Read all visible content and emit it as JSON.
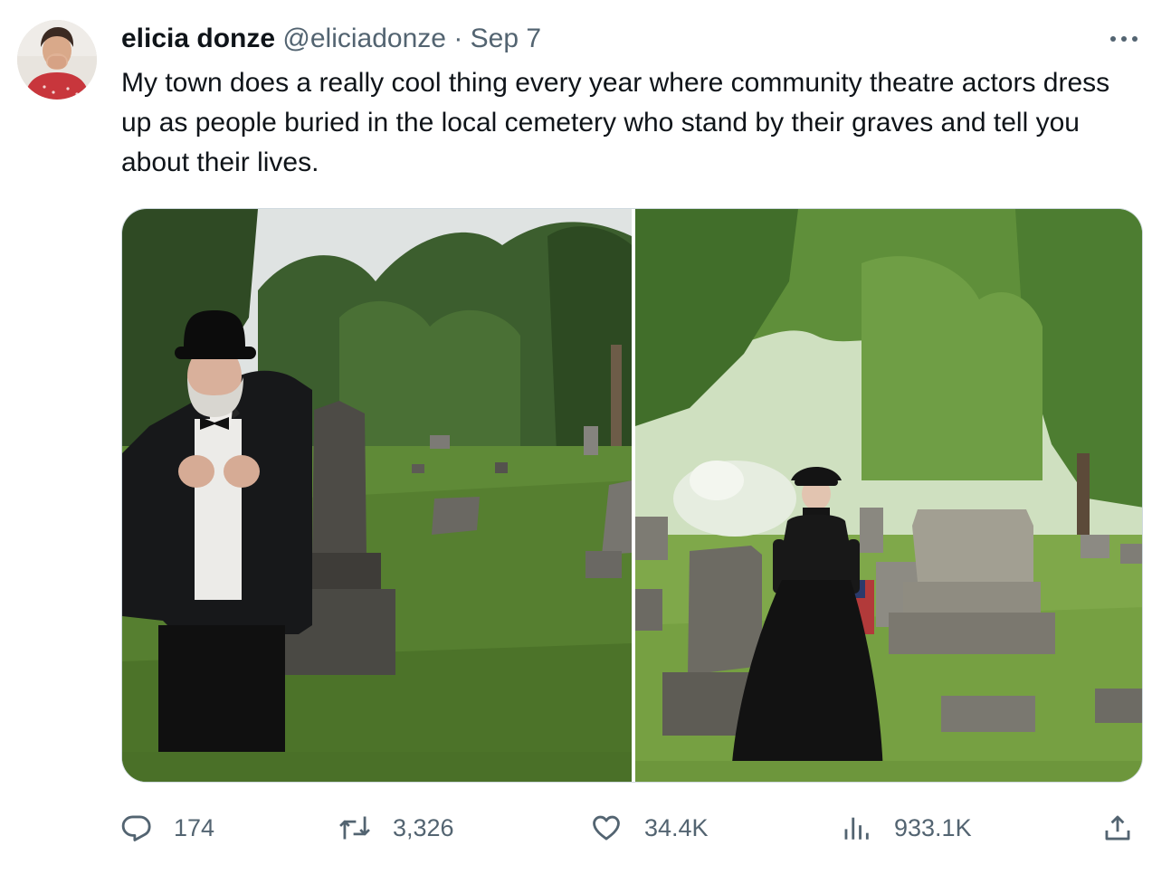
{
  "author": {
    "display_name": "elicia donze",
    "handle": "@eliciadonze",
    "separator": "·",
    "date": "Sep 7"
  },
  "more_icon": "more-horizontal-icon",
  "tweet": {
    "text": "My town does a really cool thing every year where community theatre actors dress up as people buried in the local cemetery who stand by their graves and tell you about their lives."
  },
  "media": {
    "photos": [
      {
        "subject": "man in black top hat, white beard and tuxedo beside a tall gravestone"
      },
      {
        "subject": "woman in long black dress and bonnet among gravestones"
      }
    ]
  },
  "actions": {
    "replies": {
      "icon": "reply-icon",
      "count": "174"
    },
    "reposts": {
      "icon": "repost-icon",
      "count": "3,326"
    },
    "likes": {
      "icon": "like-icon",
      "count": "34.4K"
    },
    "views": {
      "icon": "views-icon",
      "count": "933.1K"
    },
    "share": {
      "icon": "share-icon"
    }
  },
  "colors": {
    "text_primary": "#0f1419",
    "text_secondary": "#536471",
    "border": "#cfd9de"
  }
}
